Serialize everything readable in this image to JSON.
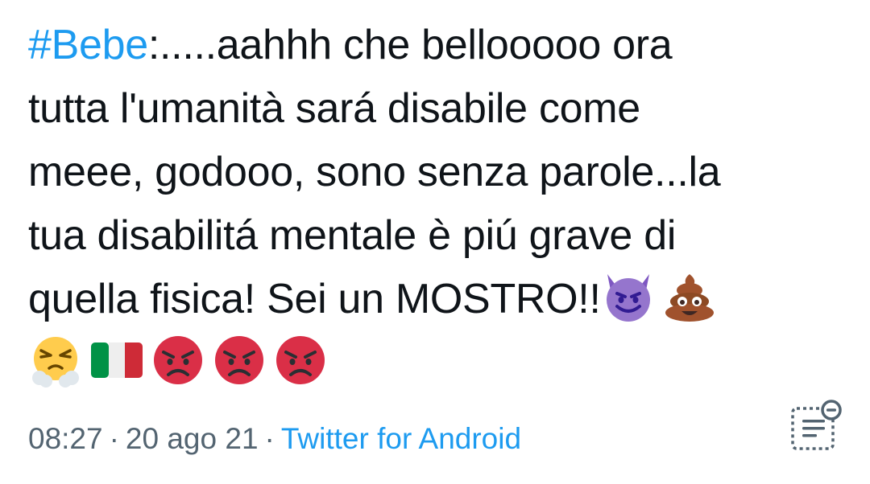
{
  "tweet": {
    "hashtag": "#Bebe",
    "lines": [
      ":.....aahhh che bellooooo ora",
      "tutta l'umanità sará disabile come",
      "meee, godooo, sono senza parole...la",
      "tua disabilitá mentale è piú grave di",
      "quella fisica! Sei un MOSTRO!!"
    ],
    "inline_emojis": [
      "smiling-imp-icon",
      "pile-of-poo-icon"
    ],
    "emoji_row": [
      "steam-from-nose-icon",
      "italy-flag-icon",
      "pouting-face-icon",
      "pouting-face-icon",
      "pouting-face-icon"
    ]
  },
  "meta": {
    "time": "08:27",
    "separator": "·",
    "date": "20 ago 21",
    "source": "Twitter for Android"
  },
  "actions": {
    "note_icon": "community-note-icon"
  },
  "colors": {
    "text": "#0f1419",
    "link": "#1d9bf0",
    "meta": "#536471"
  }
}
